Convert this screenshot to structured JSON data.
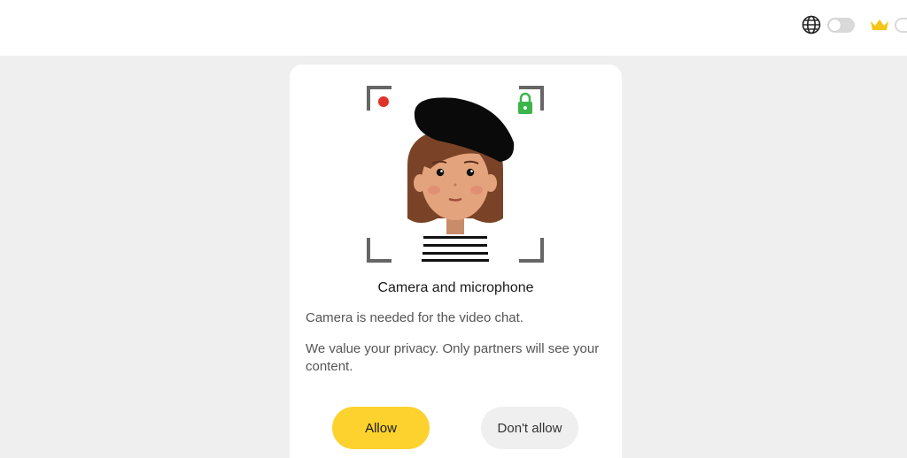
{
  "header": {
    "language_icon": "globe-icon",
    "premium_icon": "crown-icon",
    "accent_color": "#fdd22e"
  },
  "dialog": {
    "title": "Camera and microphone",
    "description": "Camera is needed for the video chat.",
    "privacy_note": "We value your privacy. Only partners will see your content.",
    "allow_label": "Allow",
    "deny_label": "Don't allow",
    "illustration": "avatar-with-beret"
  }
}
